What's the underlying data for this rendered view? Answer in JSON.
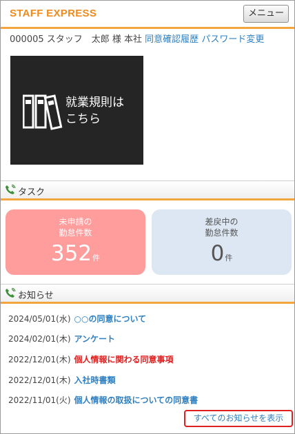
{
  "header": {
    "brand": "STAFF EXPRESS",
    "menu_label": "メニュー"
  },
  "user": {
    "info": "000005 スタッフ　太郎 様 本社",
    "consent_history_link": "同意確認履歴",
    "password_link": "パスワード変更"
  },
  "banner": {
    "text": "就業規則は\nこちら",
    "icon": "binders-icon"
  },
  "tasks": {
    "title": "タスク",
    "unapplied": {
      "label": "未申請の\n勤怠件数",
      "count": "352",
      "unit": "件",
      "color": "#ff9c9c"
    },
    "returned": {
      "label": "差戻中の\n勤怠件数",
      "count": "0",
      "unit": "件",
      "color": "#dce7f3"
    }
  },
  "notices": {
    "title": "お知らせ",
    "items": [
      {
        "date": "2024/05/01(水)",
        "title": "○○の同意について",
        "color": "#2f7fc0"
      },
      {
        "date": "2024/02/01(木)",
        "title": "アンケート",
        "color": "#2f7fc0"
      },
      {
        "date": "2022/12/01(木)",
        "title": "個人情報に関わる同意事項",
        "color": "#e01e1e"
      },
      {
        "date": "2022/12/01(木)",
        "title": "入社時書類",
        "color": "#2f7fc0"
      },
      {
        "date": "2022/11/01(火)",
        "title": "個人情報の取扱についての同意書",
        "color": "#2f7fc0"
      }
    ],
    "show_all": "すべてのお知らせを表示"
  },
  "colors": {
    "accent": "#f2a53c",
    "brand": "#f08a1c",
    "link": "#2f7fc0",
    "highlight_border": "#dd1f1f"
  }
}
